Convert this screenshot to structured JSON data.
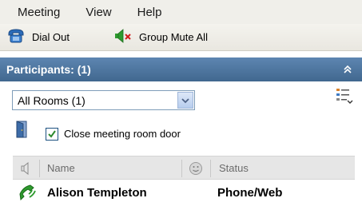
{
  "menu": {
    "items": [
      {
        "label": "Meeting"
      },
      {
        "label": "View"
      },
      {
        "label": "Help"
      }
    ]
  },
  "toolbar": {
    "dial_out_label": "Dial Out",
    "group_mute_label": "Group Mute All"
  },
  "panel": {
    "title": "Participants: (1)"
  },
  "room_select": {
    "selected": "All Rooms  (1)"
  },
  "door": {
    "checked": true,
    "label": "Close meeting room door"
  },
  "table": {
    "columns": {
      "name": "Name",
      "status": "Status"
    },
    "rows": [
      {
        "name": "Alison Templeton",
        "status": "Phone/Web"
      }
    ]
  },
  "colors": {
    "header_blue": "#4f79a3",
    "status_green": "#2e9a2e",
    "check_green": "#2d8a2d"
  }
}
